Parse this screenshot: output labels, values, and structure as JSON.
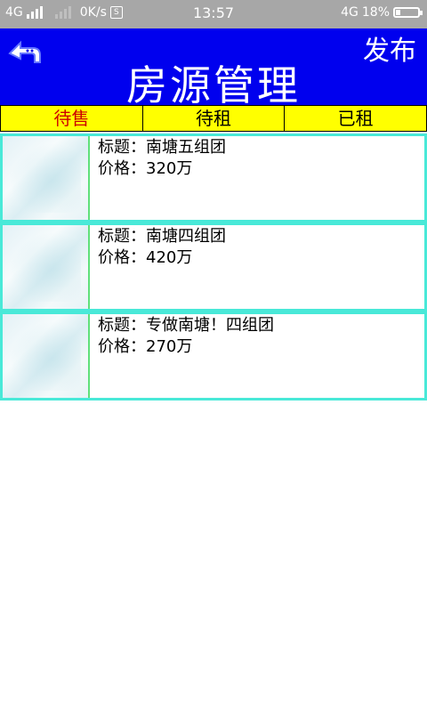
{
  "status_bar": {
    "network_left": "4G",
    "speed": "0K/s",
    "time": "13:57",
    "network_right": "4G",
    "battery": "18%"
  },
  "header": {
    "title": "房源管理",
    "publish_label": "发布",
    "background_color": "#0000ee",
    "back_icon": "back-arrow-icon"
  },
  "tabs": [
    {
      "label": "待售",
      "active": true
    },
    {
      "label": "待租",
      "active": false
    },
    {
      "label": "已租",
      "active": false
    }
  ],
  "tab_colors": {
    "background": "#ffff00",
    "active_text": "#cc0000"
  },
  "listings": [
    {
      "title_label": "标题：",
      "title": "南塘五组团",
      "price_label": "价格：",
      "price": "320万"
    },
    {
      "title_label": "标题：",
      "title": "南塘四组团",
      "price_label": "价格：",
      "price": "420万"
    },
    {
      "title_label": "标题：",
      "title": "专做南塘！四组团",
      "price_label": "价格：",
      "price": "270万"
    }
  ],
  "item_border_color": "#49e9d8"
}
